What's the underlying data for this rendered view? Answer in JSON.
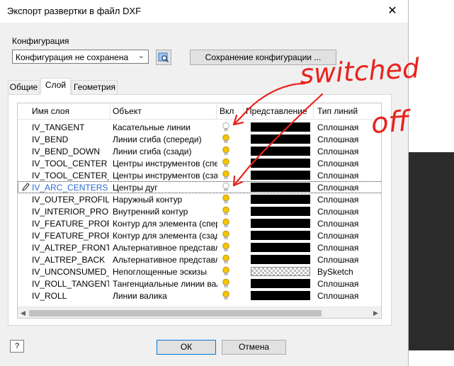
{
  "window": {
    "title": "Экспорт развертки в файл DXF",
    "close_glyph": "✕"
  },
  "config": {
    "label": "Конфигурация",
    "selected": "Конфигурация не сохранена",
    "save_button": "Сохранение конфигурации ..."
  },
  "tabs": [
    {
      "label": "Общие",
      "active": false
    },
    {
      "label": "Слой",
      "active": true
    },
    {
      "label": "Геометрия",
      "active": false
    }
  ],
  "grid": {
    "headers": {
      "name": "Имя слоя",
      "object": "Объект",
      "on": "Вкл",
      "representation": "Представление",
      "linetype": "Тип линий"
    },
    "rows": [
      {
        "name": "IV_TANGENT",
        "object": "Касательные линии",
        "on": false,
        "rep": "black",
        "linetype": "Сплошная"
      },
      {
        "name": "IV_BEND",
        "object": "Линии сгиба (спереди)",
        "on": true,
        "rep": "black",
        "linetype": "Сплошная"
      },
      {
        "name": "IV_BEND_DOWN",
        "object": "Линии сгиба (сзади)",
        "on": true,
        "rep": "black",
        "linetype": "Сплошная"
      },
      {
        "name": "IV_TOOL_CENTER",
        "object": "Центры инструментов (спере",
        "on": true,
        "rep": "black",
        "linetype": "Сплошная"
      },
      {
        "name": "IV_TOOL_CENTER_DO",
        "object": "Центры инструментов (сзади",
        "on": true,
        "rep": "black",
        "linetype": "Сплошная"
      },
      {
        "name": "IV_ARC_CENTERS",
        "object": "Центры дуг",
        "on": false,
        "rep": "black",
        "linetype": "Сплошная",
        "selected": true
      },
      {
        "name": "IV_OUTER_PROFILE",
        "object": "Наружный контур",
        "on": true,
        "rep": "black",
        "linetype": "Сплошная"
      },
      {
        "name": "IV_INTERIOR_PROFILI",
        "object": "Внутренний контур",
        "on": true,
        "rep": "black",
        "linetype": "Сплошная"
      },
      {
        "name": "IV_FEATURE_PROFILE",
        "object": "Контур для элемента (спере",
        "on": true,
        "rep": "black",
        "linetype": "Сплошная"
      },
      {
        "name": "IV_FEATURE_PROFILE",
        "object": "Контур для элемента (сзади",
        "on": true,
        "rep": "black",
        "linetype": "Сплошная"
      },
      {
        "name": "IV_ALTREP_FRONT",
        "object": "Альтернативное представле",
        "on": true,
        "rep": "black",
        "linetype": "Сплошная"
      },
      {
        "name": "IV_ALTREP_BACK",
        "object": "Альтернативное представле",
        "on": true,
        "rep": "black",
        "linetype": "Сплошная"
      },
      {
        "name": "IV_UNCONSUMED_SKE",
        "object": "Непоглощенные эскизы",
        "on": true,
        "rep": "checker",
        "linetype": "BySketch"
      },
      {
        "name": "IV_ROLL_TANGENT",
        "object": "Тангенциальные линии вали",
        "on": true,
        "rep": "black",
        "linetype": "Сплошная"
      },
      {
        "name": "IV_ROLL",
        "object": "Линии валика",
        "on": true,
        "rep": "black",
        "linetype": "Сплошная"
      }
    ]
  },
  "footer": {
    "help_glyph": "?",
    "ok": "ОК",
    "cancel": "Отмена"
  },
  "annotation": {
    "text_line1": "switched",
    "text_line2": "off",
    "color": "#e8231d"
  },
  "colors": {
    "bulb_on": "#f5c400",
    "bulb_off": "#ffffff",
    "selected_text": "#2a6bd1"
  }
}
